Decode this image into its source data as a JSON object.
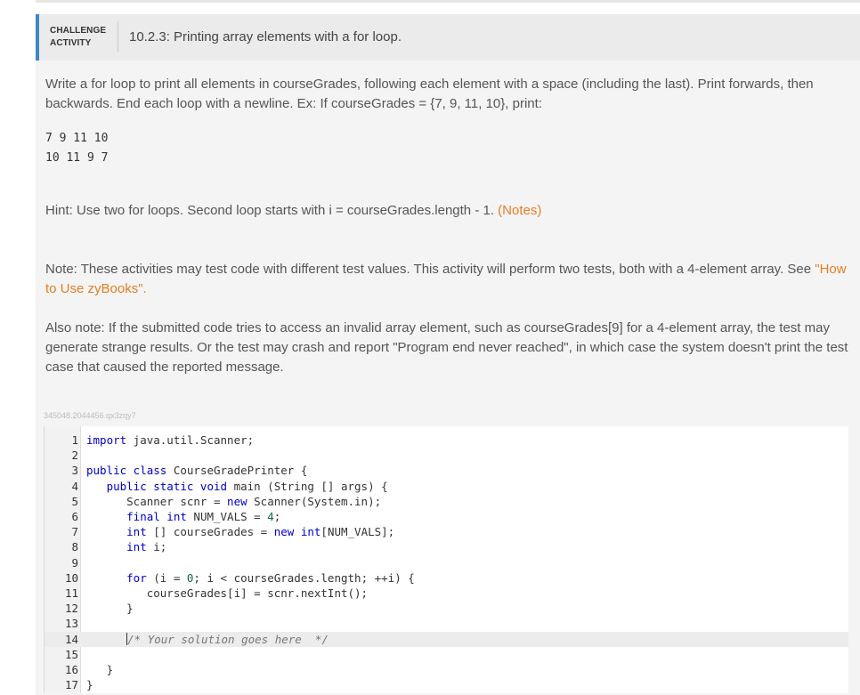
{
  "header": {
    "badge_line1": "CHALLENGE",
    "badge_line2": "ACTIVITY",
    "title": "10.2.3: Printing array elements with a for loop."
  },
  "instructions": {
    "prompt": "Write a for loop to print all elements in courseGrades, following each element with a space (including the last). Print forwards, then backwards. End each loop with a newline. Ex: If courseGrades = {7, 9, 11, 10}, print:",
    "example_line1": "7 9 11 10",
    "example_line2": "10 11 9 7",
    "hint": "Hint: Use two for loops. Second loop starts with i = courseGrades.length - 1. ",
    "hint_link": "(Notes)",
    "note": "Note: These activities may test code with different test values. This activity will perform two tests, both with a 4-element array. See ",
    "note_link": "\"How to Use zyBooks\".",
    "also_note": "Also note: If the submitted code tries to access an invalid array element, such as courseGrades[9] for a 4-element array, the test may generate strange results. Or the test may crash and report \"Program end never reached\", in which case the system doesn't print the test case that caused the reported message."
  },
  "activity_id": "345048.2044456.qx3zqy7",
  "editor": {
    "line_numbers": [
      "1",
      "2",
      "3",
      "4",
      "5",
      "6",
      "7",
      "8",
      "9",
      "10",
      "11",
      "12",
      "13",
      "14",
      "15",
      "16",
      "17"
    ],
    "lines": [
      "import java.util.Scanner;",
      "",
      "public class CourseGradePrinter {",
      "   public static void main (String [] args) {",
      "      Scanner scnr = new Scanner(System.in);",
      "      final int NUM_VALS = 4;",
      "      int [] courseGrades = new int[NUM_VALS];",
      "      int i;",
      "",
      "      for (i = 0; i < courseGrades.length; ++i) {",
      "         courseGrades[i] = scnr.nextInt();",
      "      }",
      "",
      "      /* Your solution goes here  */",
      "",
      "   }",
      "}"
    ]
  },
  "colors": {
    "accent": "#3d87c8",
    "link": "#e67e22",
    "keyword": "#0000cc"
  }
}
